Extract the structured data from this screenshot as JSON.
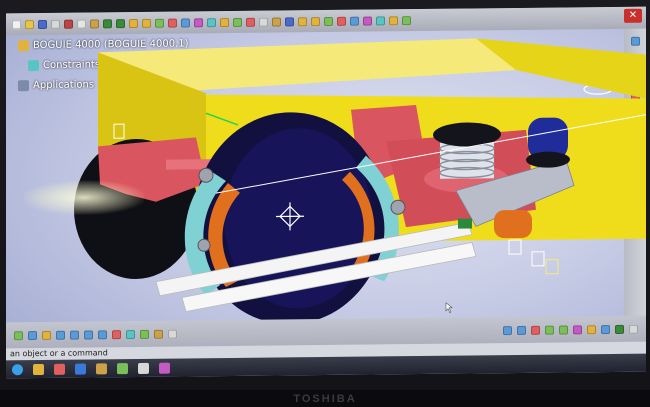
{
  "tree": {
    "root_label": "BOGUIE 4000 (BOGUIE 4000.1)",
    "items": [
      {
        "label": "Constraints",
        "icon": "constraints-icon"
      },
      {
        "label": "Applications",
        "icon": "applications-icon"
      }
    ]
  },
  "statusbar": {
    "prompt": "an object or a command"
  },
  "bezel": {
    "brand": "TOSHIBA"
  },
  "colors": {
    "frame": "#f2e21a",
    "bracket": "#d9555f",
    "wheel": "#141040",
    "brake_block": "#e0701e",
    "brake_arm": "#7fd1d4",
    "rail": "#f2f2f2",
    "spring_top": "#14141c",
    "spring_cup": "#e06470",
    "damper": "#2a3bb0"
  }
}
